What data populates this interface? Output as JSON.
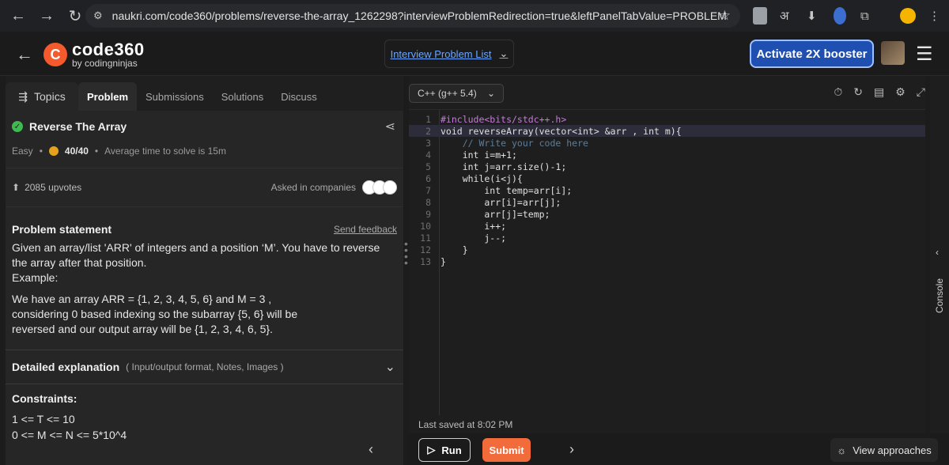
{
  "browser": {
    "url": "naukri.com/code360/problems/reverse-the-array_1262298?interviewProblemRedirection=true&leftPanelTabValue=PROBLEM",
    "ext_hindi": "अ"
  },
  "header": {
    "logo_main": "code360",
    "logo_sub": "by codingninjas",
    "problem_list": "Interview Problem List",
    "activate_label": "Activate 2X booster"
  },
  "left": {
    "topics": "Topics",
    "tabs": [
      "Problem",
      "Submissions",
      "Solutions",
      "Discuss"
    ],
    "title": "Reverse The Array",
    "difficulty": "Easy",
    "score": "40/40",
    "avg_time": "Average time to solve is 15m",
    "upvotes": "2085 upvotes",
    "asked": "Asked in companies",
    "statement_title": "Problem statement",
    "send_feedback": "Send feedback",
    "para1": "Given an array/list 'ARR' of integers and a position ‘M’. You have to reverse the array after that position.",
    "example": "Example:",
    "para2": "We have an array ARR = {1, 2, 3, 4, 5, 6} and M = 3 , considering 0 based indexing so the subarray {5, 6} will be reversed and our output array will be {1, 2, 3, 4, 6, 5}.",
    "detailed": "Detailed explanation",
    "detailed_sub": "( Input/output format, Notes, Images )",
    "constraints_title": "Constraints:",
    "constraints": [
      "1 <= T <= 10",
      "0 <= M <= N <= 5*10^4"
    ]
  },
  "right": {
    "language": "C++ (g++ 5.4)",
    "last_saved": "Last saved at 8:02 PM",
    "console": "Console"
  },
  "code_lines": [
    "#include<bits/stdc++.h>",
    "void reverseArray(vector<int> &arr , int m){",
    "    // Write your code here",
    "    int i=m+1;",
    "    int j=arr.size()-1;",
    "    while(i<j){",
    "        int temp=arr[i];",
    "        arr[i]=arr[j];",
    "        arr[j]=temp;",
    "        i++;",
    "        j--;",
    "    }",
    "}"
  ],
  "bottom": {
    "run": "Run",
    "submit": "Submit",
    "approaches": "View approaches"
  },
  "colors": {
    "accent_orange": "#f26b3a",
    "activate_blue": "#1f4fb0",
    "success_green": "#3fb950"
  }
}
